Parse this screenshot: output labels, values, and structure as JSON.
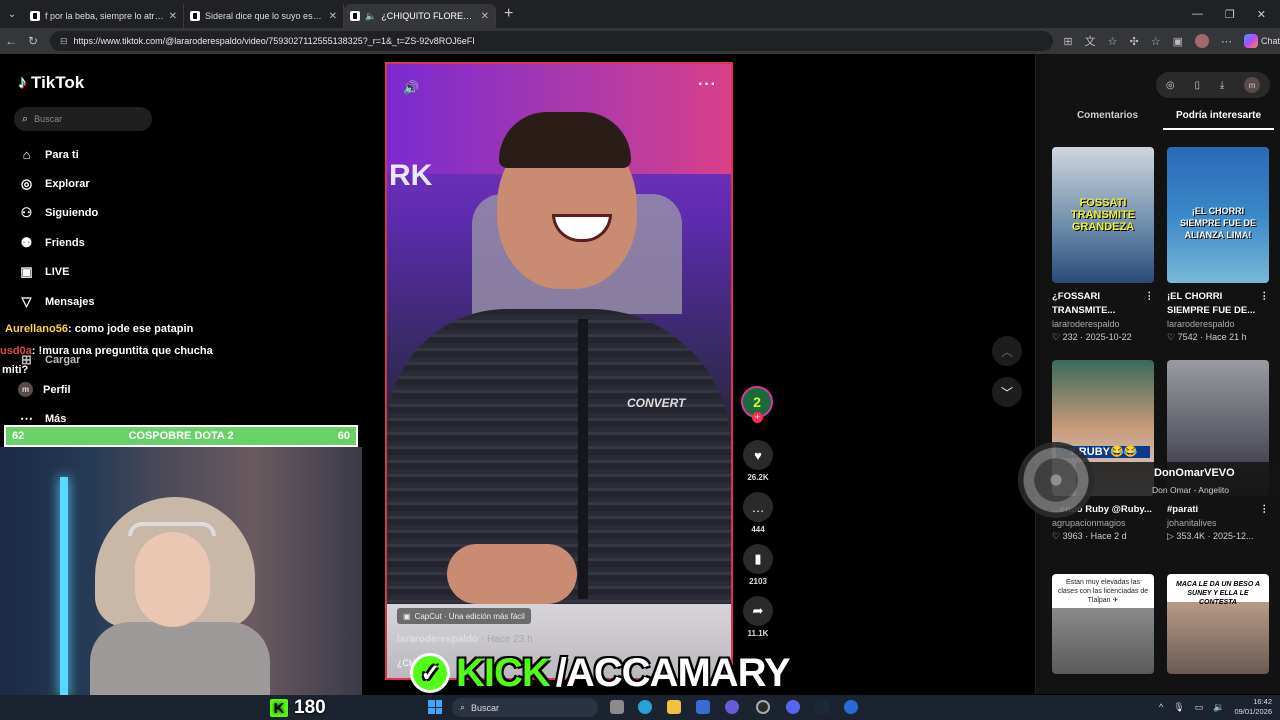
{
  "browser": {
    "tabs": [
      {
        "title": "f por la beba, siempre lo atrasan 🥱",
        "active": false
      },
      {
        "title": "Sideral dice que lo suyo es lento s",
        "active": false
      },
      {
        "title": "¿CHIQUITO FLORES LE VA A L",
        "active": true
      }
    ],
    "url": "https://www.tiktok.com/@lararoderespaldo/video/7593027112555138325?_r=1&_t=ZS-92v8ROJ6eFI",
    "chat_label": "Chat"
  },
  "tiktok": {
    "logo": "TikTok",
    "search_placeholder": "Buscar",
    "menu": [
      {
        "label": "Para ti",
        "icon": "home-icon"
      },
      {
        "label": "Explorar",
        "icon": "compass-icon"
      },
      {
        "label": "Siguiendo",
        "icon": "following-icon"
      },
      {
        "label": "Friends",
        "icon": "friends-icon"
      },
      {
        "label": "LIVE",
        "icon": "live-icon"
      },
      {
        "label": "Mensajes",
        "icon": "message-icon"
      },
      {
        "label": "Cargar",
        "icon": "upload-icon"
      },
      {
        "label": "Perfil",
        "icon": "profile-icon"
      },
      {
        "label": "Más",
        "icon": "more-icon"
      }
    ],
    "profile_initial": "m",
    "video": {
      "capcut": "CapCut · Una edición más fácil",
      "author": "lararoderespaldo",
      "time": "· Hace 23 h",
      "caption": "¿CHI",
      "wall_text": "RK",
      "shirt_logo": "CONVERT"
    },
    "actions": {
      "creator_initial": "2",
      "likes": "26.2K",
      "comments": "444",
      "saves": "2103",
      "shares": "11.1K"
    },
    "right_panel": {
      "tabs": [
        "Comentarios",
        "Podría interesarte"
      ],
      "active_tab": 1,
      "cards": [
        {
          "title": "¿FOSSARI TRANSMITE...",
          "author": "lararoderespaldo",
          "views": "232",
          "date": "2025-10-22",
          "thumb_text": "FOSSATI TRANSMITE GRANDEZA"
        },
        {
          "title": "¡EL CHORRI SIEMPRE FUE DE...",
          "author": "lararoderespaldo",
          "views": "7542",
          "date": "Hace 21 h",
          "thumb_text": "¡EL CHORRI SIEMPRE FUE DE ALIANZA LIMA!"
        },
        {
          "title": "...endo Ruby @Ruby...",
          "author": "agrupacionmagios",
          "views": "3963",
          "date": "Hace 2 d",
          "thumb_text": "Y RUBY😂😂"
        },
        {
          "title": "#parati",
          "author": "johanitalives",
          "views": "353.4K",
          "date": "2025-12...",
          "thumb_text": ""
        },
        {
          "title": "",
          "author": "",
          "views": "",
          "date": "",
          "thumb_text": "Estan muy elevadas las clases con las licenciadas de Tlalpan ✈"
        },
        {
          "title": "",
          "author": "",
          "views": "",
          "date": "",
          "thumb_text": "MACA LE DA UN BESO A SUNEY Y ELLA LE CONTESTA"
        }
      ]
    }
  },
  "stream": {
    "chat": [
      {
        "user": "Aurellano56",
        "message": "como jode ese patapin"
      },
      {
        "user": "usd0a",
        "message": "!mura una preguntita que chucha"
      },
      {
        "user": "",
        "message": "miti?"
      }
    ],
    "poll": {
      "left": "62",
      "label": "COSPOBRE DOTA 2",
      "right": "60"
    },
    "kick_viewers": "180",
    "banner": {
      "part1": "KICK",
      "part2": "/ACCAMARY"
    },
    "music": {
      "title": "DonOmarVEVO",
      "subtitle": "Don Omar - Angelito"
    }
  },
  "taskbar": {
    "search_label": "Buscar",
    "time": "16:42",
    "date": "09/01/2026"
  },
  "colors": {
    "tiktok_red": "#fe2c55",
    "kick_green": "#53fc18",
    "poll_green": "#68d168",
    "video_border": "#e0324a"
  }
}
